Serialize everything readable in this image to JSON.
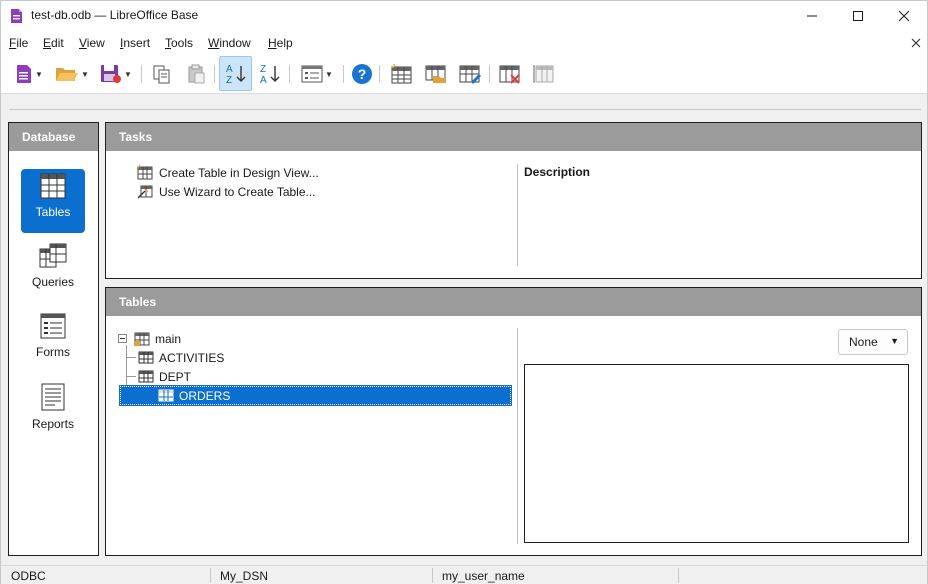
{
  "window": {
    "title": "test-db.odb — LibreOffice Base"
  },
  "menu": {
    "items": [
      {
        "label": "File",
        "hotkey": "F"
      },
      {
        "label": "Edit",
        "hotkey": "E"
      },
      {
        "label": "View",
        "hotkey": "V"
      },
      {
        "label": "Insert",
        "hotkey": "I"
      },
      {
        "label": "Tools",
        "hotkey": "T"
      },
      {
        "label": "Window",
        "hotkey": "W"
      },
      {
        "label": "Help",
        "hotkey": "H"
      }
    ]
  },
  "toolbar": {
    "buttons": [
      {
        "name": "new-document",
        "icon": "new-document-icon",
        "dropdown": true
      },
      {
        "name": "open",
        "icon": "folder-open-icon",
        "dropdown": true
      },
      {
        "name": "save",
        "icon": "save-icon",
        "dropdown": true
      },
      {
        "name": "copy",
        "icon": "copy-icon"
      },
      {
        "name": "paste",
        "icon": "paste-icon"
      },
      {
        "name": "sort-ascending",
        "icon": "sort-ascending-icon",
        "active": true
      },
      {
        "name": "sort-descending",
        "icon": "sort-descending-icon"
      },
      {
        "name": "form-view",
        "icon": "form-icon",
        "dropdown": true
      },
      {
        "name": "help",
        "icon": "help-icon"
      },
      {
        "name": "create-table-design",
        "icon": "table-new-icon"
      },
      {
        "name": "open-table",
        "icon": "table-open-icon"
      },
      {
        "name": "edit-table",
        "icon": "table-edit-icon"
      },
      {
        "name": "delete-table",
        "icon": "table-delete-icon"
      },
      {
        "name": "rename-table",
        "icon": "table-rename-icon"
      }
    ]
  },
  "database_panel": {
    "header": "Database",
    "items": [
      {
        "label": "Tables",
        "icon": "tables-icon",
        "selected": true
      },
      {
        "label": "Queries",
        "icon": "queries-icon",
        "selected": false
      },
      {
        "label": "Forms",
        "icon": "forms-icon",
        "selected": false
      },
      {
        "label": "Reports",
        "icon": "reports-icon",
        "selected": false
      }
    ]
  },
  "tasks_panel": {
    "header": "Tasks",
    "tasks": [
      {
        "label": "Create Table in Design View...",
        "icon": "table-design-icon"
      },
      {
        "label": "Use Wizard to Create Table...",
        "icon": "wizard-icon"
      }
    ],
    "description_title": "Description"
  },
  "tables_panel": {
    "header": "Tables",
    "tree": {
      "root": {
        "label": "main",
        "expanded": true
      },
      "children": [
        {
          "label": "ACTIVITIES",
          "selected": false
        },
        {
          "label": "DEPT",
          "selected": false
        },
        {
          "label": "ORDERS",
          "selected": true
        }
      ]
    },
    "preview_select": {
      "value": "None"
    }
  },
  "statusbar": {
    "cells": [
      "ODBC",
      "My_DSN",
      "my_user_name"
    ]
  },
  "colors": {
    "accent": "#0b6fd0",
    "panel_header": "#9b9b9b",
    "active_tool": "#cce4f7"
  }
}
